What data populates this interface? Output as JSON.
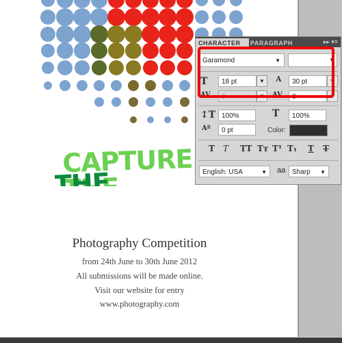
{
  "poster": {
    "headline_line1": "CAPTURE THE",
    "headline_line2": "THE BEAUTY",
    "title": "Photography Competition",
    "lines": [
      "from 24th June to 30th June 2012",
      "All submissions will be made online.",
      "Visit our website for entry",
      "www.photography.com"
    ]
  },
  "panel": {
    "tabs": [
      "CHARACTER",
      "PARAGRAPH"
    ],
    "font_family": "Garamond",
    "font_style": "",
    "font_size": "18 pt",
    "leading": "30 pt",
    "kerning": "0",
    "tracking": "0",
    "vertical_scale": "100%",
    "horizontal_scale": "100%",
    "baseline_shift": "0 pt",
    "color_label": "Color:",
    "color": "#2e2e2e",
    "style_buttons": [
      "T",
      "T",
      "TT",
      "Tт",
      "T¹",
      "T₁",
      "T",
      "T"
    ],
    "language": "English: USA",
    "antialias_label": "aa",
    "antialias": "Sharp",
    "highlight_color": "#ee0000"
  }
}
